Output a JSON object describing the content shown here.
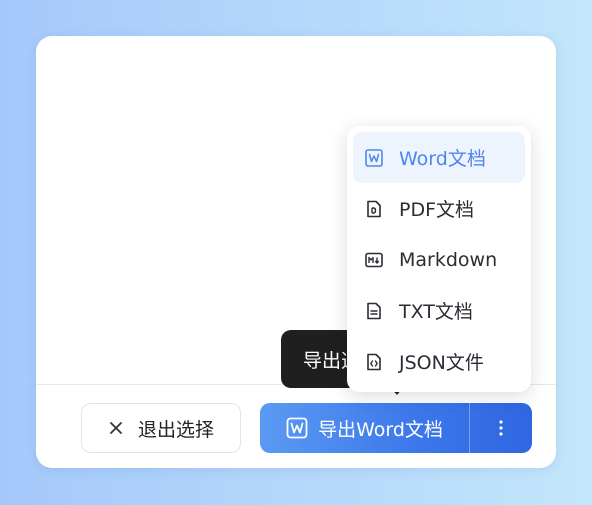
{
  "footer": {
    "exit_label": "退出选择",
    "export_label": "导出Word文档"
  },
  "tooltip": {
    "text": "导出选"
  },
  "export_menu": {
    "items": [
      {
        "label": "Word文档",
        "icon": "word-doc-icon",
        "active": true
      },
      {
        "label": "PDF文档",
        "icon": "pdf-doc-icon",
        "active": false
      },
      {
        "label": "Markdown",
        "icon": "markdown-icon",
        "active": false
      },
      {
        "label": "TXT文档",
        "icon": "txt-doc-icon",
        "active": false
      },
      {
        "label": "JSON文件",
        "icon": "json-file-icon",
        "active": false
      }
    ]
  },
  "colors": {
    "accent": "#3b76ea",
    "active_item_text": "#4f86ec",
    "active_item_bg": "#eef4fd",
    "tooltip_bg": "#1f1f1f"
  }
}
